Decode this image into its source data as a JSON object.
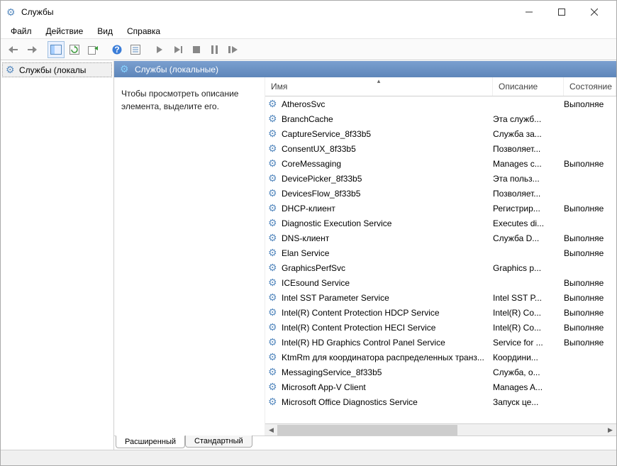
{
  "title": "Службы",
  "menu": {
    "file": "Файл",
    "action": "Действие",
    "view": "Вид",
    "help": "Справка"
  },
  "tree": {
    "root": "Службы (локалы"
  },
  "header_banner": "Службы (локальные)",
  "detail_hint": "Чтобы просмотреть описание элемента, выделите его.",
  "columns": {
    "name": "Имя",
    "desc": "Описание",
    "state": "Состояние"
  },
  "tabs": {
    "extended": "Расширенный",
    "standard": "Стандартный"
  },
  "services": [
    {
      "name": "AtherosSvc",
      "desc": "",
      "state": "Выполняе"
    },
    {
      "name": "BranchCache",
      "desc": "Эта служб...",
      "state": ""
    },
    {
      "name": "CaptureService_8f33b5",
      "desc": "Служба за...",
      "state": ""
    },
    {
      "name": "ConsentUX_8f33b5",
      "desc": "Позволяет...",
      "state": ""
    },
    {
      "name": "CoreMessaging",
      "desc": "Manages c...",
      "state": "Выполняе"
    },
    {
      "name": "DevicePicker_8f33b5",
      "desc": "Эта польз...",
      "state": ""
    },
    {
      "name": "DevicesFlow_8f33b5",
      "desc": "Позволяет...",
      "state": ""
    },
    {
      "name": "DHCP-клиент",
      "desc": "Регистрир...",
      "state": "Выполняе"
    },
    {
      "name": "Diagnostic Execution Service",
      "desc": "Executes di...",
      "state": ""
    },
    {
      "name": "DNS-клиент",
      "desc": "Служба D...",
      "state": "Выполняе"
    },
    {
      "name": "Elan Service",
      "desc": "",
      "state": "Выполняе"
    },
    {
      "name": "GraphicsPerfSvc",
      "desc": "Graphics p...",
      "state": ""
    },
    {
      "name": "ICEsound Service",
      "desc": "",
      "state": "Выполняе"
    },
    {
      "name": "Intel SST Parameter Service",
      "desc": "Intel SST P...",
      "state": "Выполняе"
    },
    {
      "name": "Intel(R) Content Protection HDCP Service",
      "desc": "Intel(R) Co...",
      "state": "Выполняе"
    },
    {
      "name": "Intel(R) Content Protection HECI Service",
      "desc": "Intel(R) Co...",
      "state": "Выполняе"
    },
    {
      "name": "Intel(R) HD Graphics Control Panel Service",
      "desc": "Service for ...",
      "state": "Выполняе"
    },
    {
      "name": "KtmRm для координатора распределенных транз...",
      "desc": "Координи...",
      "state": ""
    },
    {
      "name": "MessagingService_8f33b5",
      "desc": "Служба, о...",
      "state": ""
    },
    {
      "name": "Microsoft App-V Client",
      "desc": "Manages A...",
      "state": ""
    },
    {
      "name": "Microsoft Office Diagnostics Service",
      "desc": "Запуск це...",
      "state": ""
    }
  ]
}
